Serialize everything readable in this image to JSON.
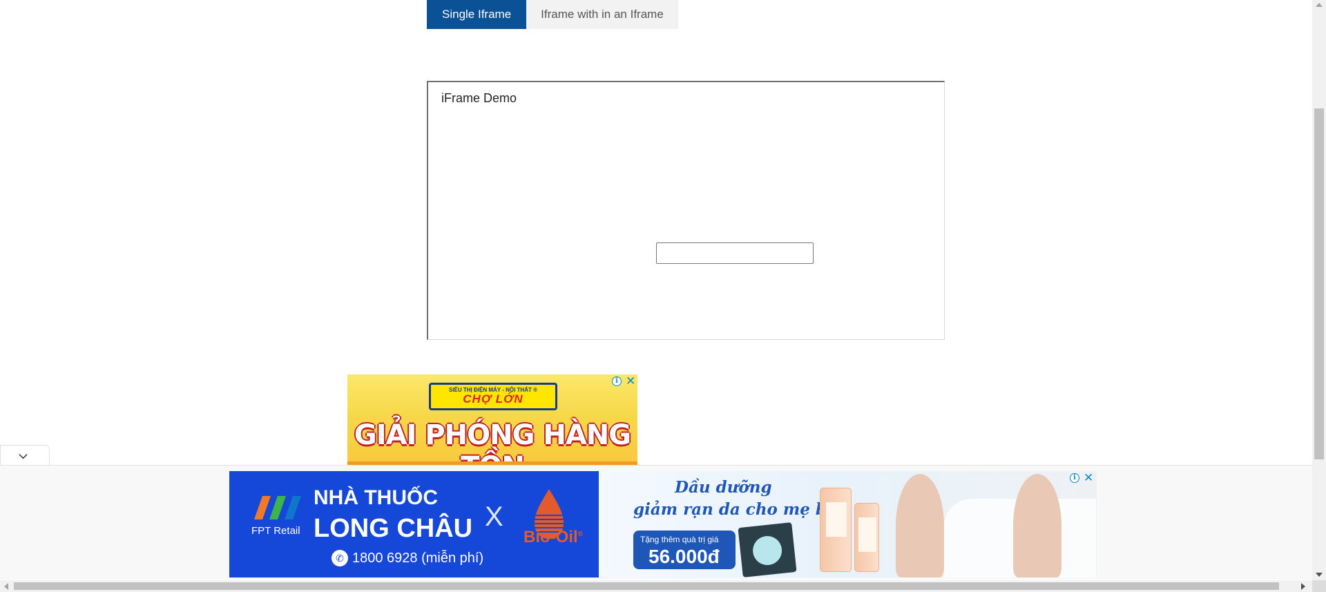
{
  "tabs": [
    {
      "label": "Single Iframe",
      "active": true
    },
    {
      "label": "Iframe with in an Iframe",
      "active": false
    }
  ],
  "iframe": {
    "title": "iFrame Demo",
    "input_value": "",
    "input_placeholder": ""
  },
  "ad_inline": {
    "brand_top": "SIÊU THỊ ĐIỆN MÁY - NỘI THẤT ®",
    "brand_main": "CHỢ LỚN",
    "headline": "GIẢI PHÓNG HÀNG TỒN"
  },
  "ad_anchor": {
    "fpt_text": "FPT Retail",
    "title_line1": "NHÀ THUỐC",
    "title_line2": "LONG CHÂU",
    "separator": "X",
    "partner": "Bio-Oil",
    "partner_mark": "®",
    "phone": "1800 6928 (miễn phí)",
    "headline_line1": "Dầu dưỡng",
    "headline_line2": "giảm rạn da cho mẹ bầu",
    "promo_small": "Tặng thêm quà trị giá",
    "promo_amount": "56.000đ"
  },
  "colors": {
    "tab_active_bg": "#0a5195",
    "tab_inactive_bg": "#f2f2f2",
    "ad_info": "#0a88c4",
    "long_chau_blue": "#1547d9"
  },
  "icons": {
    "ad_info": "info-icon",
    "ad_close": "close-icon",
    "anchor_toggle": "chevron-down-icon",
    "phone": "phone-icon"
  }
}
